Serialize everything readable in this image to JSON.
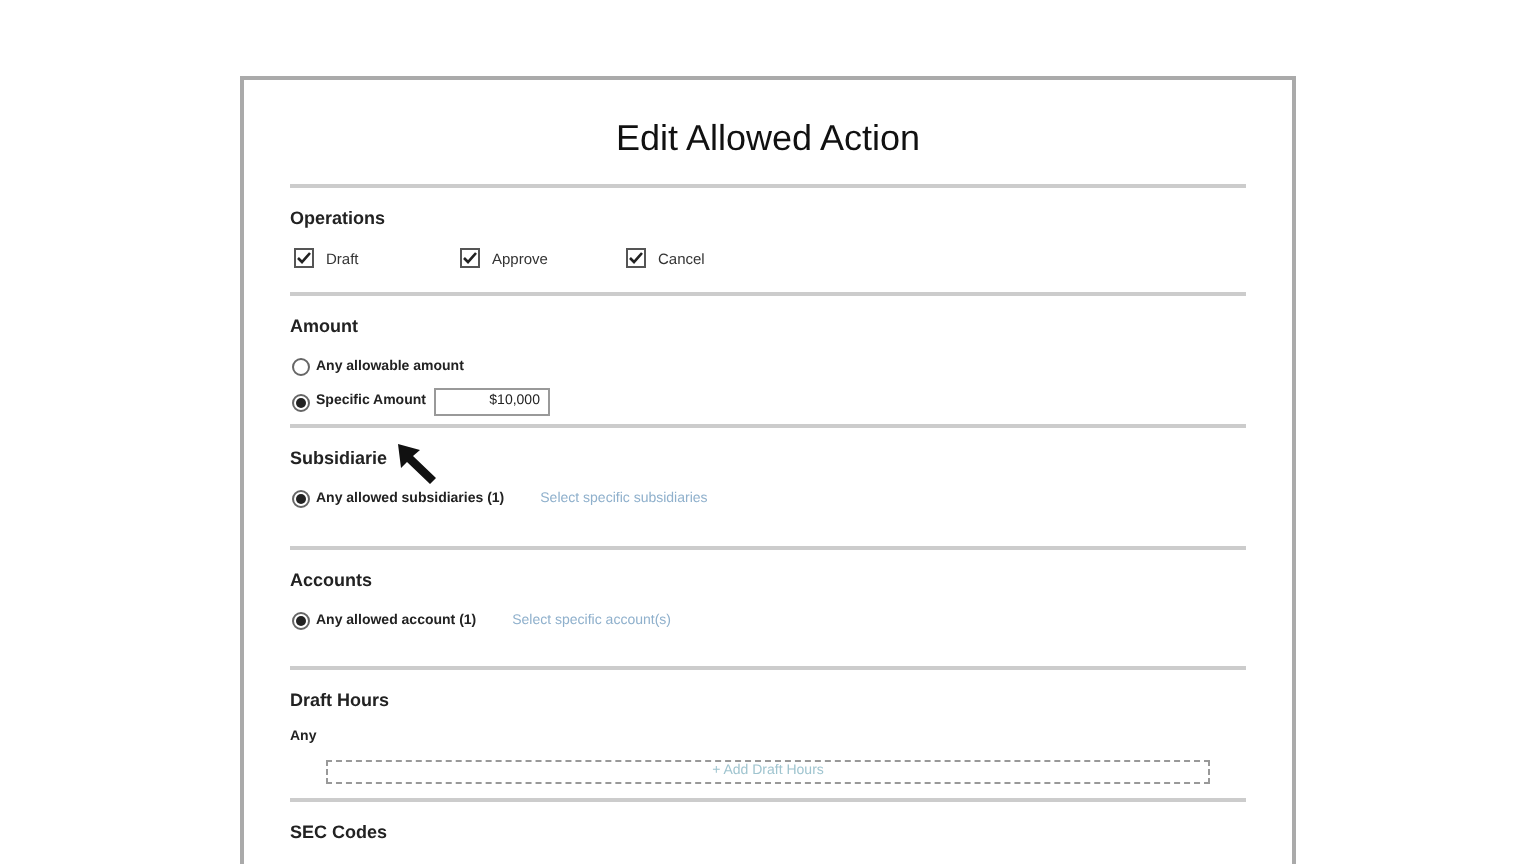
{
  "dialog": {
    "title": "Edit Allowed Action"
  },
  "sections": [
    {
      "kind": "checkboxes",
      "title": "Operations",
      "options": [
        {
          "label": "Draft",
          "checked": true
        },
        {
          "label": "Approve",
          "checked": true
        },
        {
          "label": "Cancel",
          "checked": true
        }
      ]
    },
    {
      "kind": "radios",
      "title": "Amount",
      "options": [
        {
          "label": "Any allowable amount",
          "selected": false
        },
        {
          "label": "Specific Amount",
          "selected": true,
          "value": "$10,000"
        }
      ]
    },
    {
      "kind": "radios",
      "title": "Subsidiarie",
      "cursor": true,
      "options": [
        {
          "label": "Any allowed subsidiaries (1)",
          "selected": true,
          "link": "Select specific subsidiaries"
        }
      ]
    },
    {
      "kind": "radios",
      "title": "Accounts",
      "options": [
        {
          "label": "Any allowed account (1)",
          "selected": true,
          "link": "Select specific account(s)"
        }
      ]
    },
    {
      "kind": "hours",
      "title": "Draft Hours",
      "value": "Any",
      "add_button": "+ Add Draft Hours"
    },
    {
      "kind": "heading",
      "title": "SEC Codes"
    }
  ]
}
